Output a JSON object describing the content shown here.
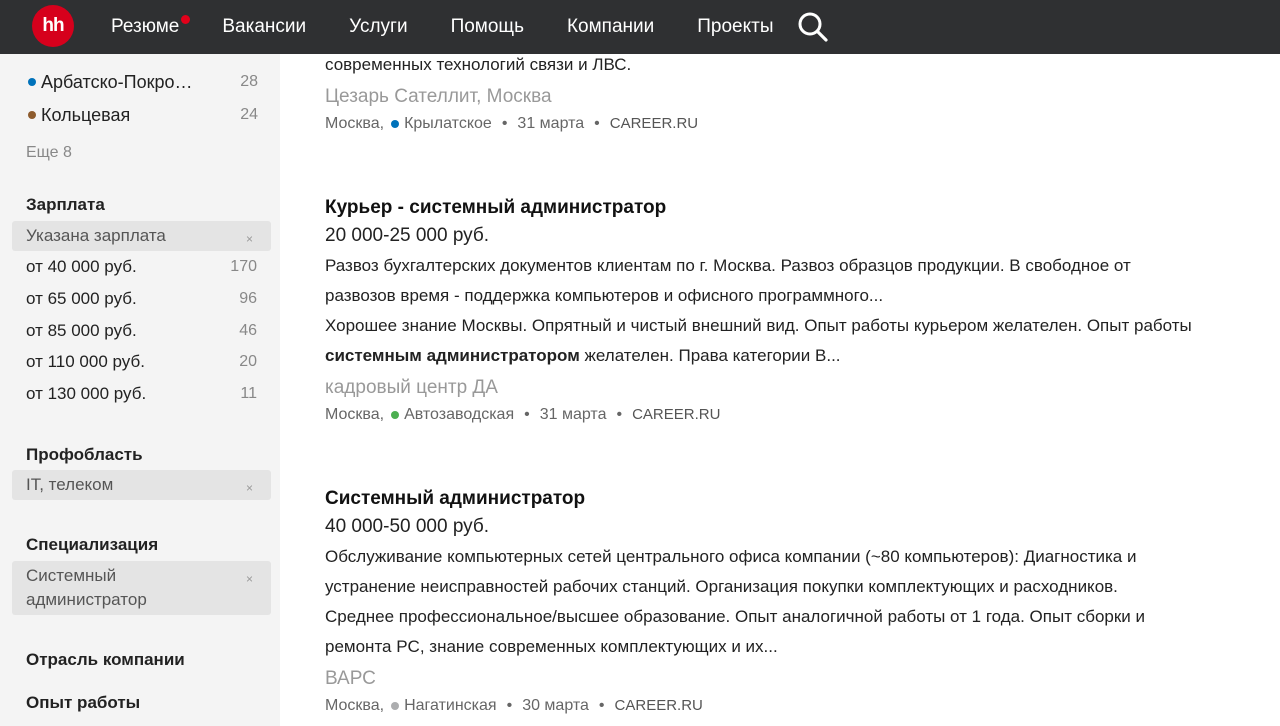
{
  "header": {
    "logo_text": "hh",
    "nav": [
      "Резюме",
      "Вакансии",
      "Услуги",
      "Помощь",
      "Компании",
      "Проекты"
    ],
    "accent": "#d6001c"
  },
  "sidebar": {
    "metro": [
      {
        "label": "Арбатско-Покро…",
        "count": "28",
        "color": "#0072ba"
      },
      {
        "label": "Кольцевая",
        "count": "24",
        "color": "#8d5b2d"
      }
    ],
    "more_label": "Еще 8",
    "salary": {
      "title": "Зарплата",
      "selected": "Указана зарплата",
      "options": [
        {
          "label": "от 40 000 руб.",
          "count": "170"
        },
        {
          "label": "от 65 000 руб.",
          "count": "96"
        },
        {
          "label": "от 85 000 руб.",
          "count": "46"
        },
        {
          "label": "от 110 000 руб.",
          "count": "20"
        },
        {
          "label": "от 130 000 руб.",
          "count": "11"
        }
      ]
    },
    "prof": {
      "title": "Профобласть",
      "selected": "IT, телеком"
    },
    "spec": {
      "title": "Специализация",
      "selected_line1": "Системный",
      "selected_line2": "администратор"
    },
    "industry": {
      "title": "Отрасль компании"
    },
    "experience": {
      "title": "Опыт работы"
    },
    "remove_icon": "×"
  },
  "vacancies": [
    {
      "snippet_tail": "современных технологий связи и ЛВС.",
      "company": "Цезарь Сателлит, Москва",
      "city": "Москва,",
      "metro": "Крылатское",
      "metro_color": "#0072ba",
      "date": "31 марта",
      "source": "CAREER.RU"
    },
    {
      "title": "Курьер - системный администратор",
      "salary": "20 000-25 000 руб.",
      "resp_1": "Развоз бухгалтерских документов клиентам по г. Москва. Развоз образцов продукции. В свободное от",
      "resp_2": "развозов время - поддержка компьютеров и офисного программного...",
      "req_1": "Хорошее знание Москвы. Опрятный и чистый внешний вид. Опыт работы курьером желателен. Опыт работы",
      "req_2_bold": "системным администратором",
      "req_2_rest": " желателен. Права категории В...",
      "company": "кадровый центр ДА",
      "city": "Москва,",
      "metro": "Автозаводская",
      "metro_color": "#4caf50",
      "date": "31 марта",
      "source": "CAREER.RU"
    },
    {
      "title": "Системный администратор",
      "salary": "40 000-50 000 руб.",
      "resp_1": "Обслуживание компьютерных сетей центрального офиса компании (~80 компьютеров): Диагностика и",
      "resp_2": "устранение неисправностей рабочих станций. Организация покупки комплектующих и расходников.",
      "req_1": "Среднее профессиональное/высшее образование. Опыт аналогичной работы от 1 года. Опыт сборки и",
      "req_2": "ремонта PC, знание современных комплектующих и их...",
      "company": "ВАРС",
      "city": "Москва,",
      "metro": "Нагатинская",
      "metro_color": "#acadaf",
      "date": "30 марта",
      "source": "CAREER.RU"
    }
  ],
  "separator": "•"
}
